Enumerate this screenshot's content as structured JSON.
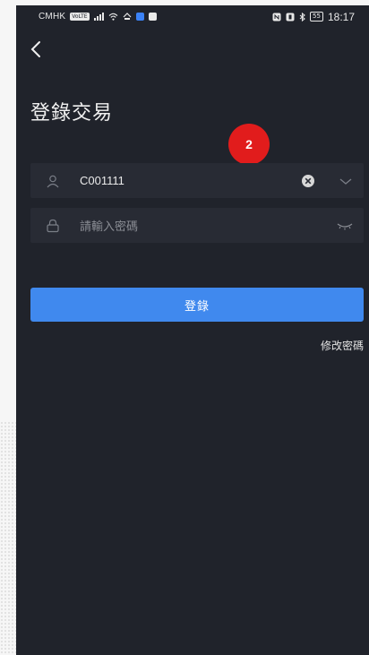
{
  "status_bar": {
    "carrier": "CMHK",
    "carrier_badge": "VoLTE",
    "battery": "55",
    "time": "18:17"
  },
  "header": {
    "back_icon": "chevron-left-icon",
    "title": "登錄交易"
  },
  "step_badge": "2",
  "form": {
    "account": {
      "icon": "user-icon",
      "value": "C001111",
      "clear_icon": "clear-circle-icon",
      "dropdown_icon": "chevron-down-icon"
    },
    "password": {
      "icon": "lock-icon",
      "placeholder": "請輸入密碼",
      "toggle_icon": "eye-closed-icon"
    },
    "login_label": "登錄",
    "change_password_label": "修改密碼"
  },
  "colors": {
    "background": "#20232b",
    "field": "#282b34",
    "primary": "#4089ee",
    "badge": "#e11c1c"
  }
}
